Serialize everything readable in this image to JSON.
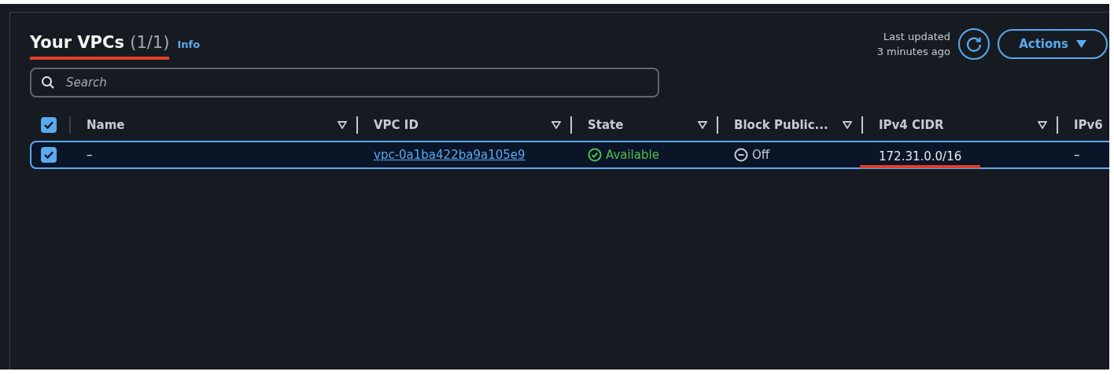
{
  "header": {
    "title": "Your VPCs",
    "count": "(1/1)",
    "highlighted": true,
    "info_link": "Info",
    "last_updated": [
      "Last updated",
      "3 minutes ago"
    ],
    "actions_button": "Actions"
  },
  "search": {
    "placeholder": "Search"
  },
  "table": {
    "select_all_checked": true,
    "columns": [
      {
        "label": "Name",
        "sortable": true
      },
      {
        "label": "VPC ID",
        "sortable": true
      },
      {
        "label": "State",
        "sortable": true
      },
      {
        "label": "Block Public...",
        "sortable": true
      },
      {
        "label": "IPv4 CIDR",
        "sortable": true
      },
      {
        "label": "IPv6"
      }
    ],
    "rows": [
      {
        "selected": true,
        "checked": true,
        "cells": [
          {
            "kind": "text",
            "text": "–"
          },
          {
            "kind": "link",
            "text": "vpc-0a1ba422ba9a105e9"
          },
          {
            "kind": "ok",
            "text": "Available"
          },
          {
            "kind": "off",
            "text": "Off"
          },
          {
            "kind": "text",
            "text": "172.31.0.0/16",
            "highlighted": true
          },
          {
            "kind": "text",
            "text": "–"
          }
        ]
      }
    ]
  }
}
